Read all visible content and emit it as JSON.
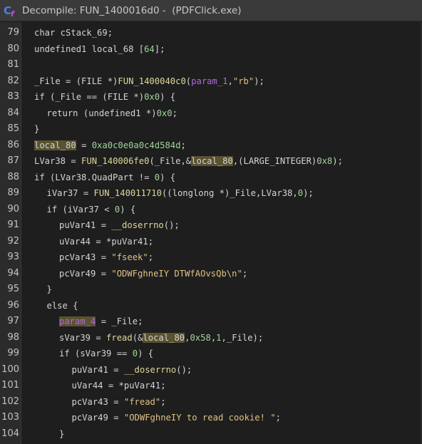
{
  "window": {
    "title": "Decompile: FUN_1400016d0 -  (PDFClick.exe)",
    "icon": "decompiler-icon"
  },
  "colors": {
    "background": "#1e1e1e",
    "text": "#d4d4d4",
    "function": "#ded89a",
    "number": "#9fd49a",
    "string": "#e0c184",
    "parameter": "#b06ad8",
    "highlight": "#5a5230"
  },
  "lines": [
    {
      "num": "79",
      "indent": 1,
      "tokens": [
        [
          "char cStack_69;",
          "t"
        ]
      ]
    },
    {
      "num": "80",
      "indent": 1,
      "tokens": [
        [
          "undefined1 local_68 [",
          "t"
        ],
        [
          "64",
          "n"
        ],
        [
          "];",
          "t"
        ]
      ]
    },
    {
      "num": "81",
      "indent": 0,
      "tokens": []
    },
    {
      "num": "82",
      "indent": 1,
      "tokens": [
        [
          "_File = (FILE *)",
          "t"
        ],
        [
          "FUN_1400040c0",
          "f"
        ],
        [
          "(",
          "t"
        ],
        [
          "param_1",
          "p"
        ],
        [
          ",",
          "t"
        ],
        [
          "\"rb\"",
          "s"
        ],
        [
          ");",
          "t"
        ]
      ]
    },
    {
      "num": "83",
      "indent": 1,
      "tokens": [
        [
          "if (_File == (FILE *)",
          "t"
        ],
        [
          "0x0",
          "n"
        ],
        [
          ") {",
          "t"
        ]
      ]
    },
    {
      "num": "84",
      "indent": 2,
      "tokens": [
        [
          "return (undefined1 *)",
          "t"
        ],
        [
          "0x0",
          "n"
        ],
        [
          ";",
          "t"
        ]
      ]
    },
    {
      "num": "85",
      "indent": 1,
      "tokens": [
        [
          "}",
          "t"
        ]
      ]
    },
    {
      "num": "86",
      "indent": 1,
      "tokens": [
        [
          "local_80",
          "h"
        ],
        [
          " = ",
          "t"
        ],
        [
          "0xa0c0e0a0c4d584d",
          "n"
        ],
        [
          ";",
          "t"
        ]
      ]
    },
    {
      "num": "87",
      "indent": 1,
      "tokens": [
        [
          "LVar38 = ",
          "t"
        ],
        [
          "FUN_140006fe0",
          "f"
        ],
        [
          "(_File,&",
          "t"
        ],
        [
          "local_80",
          "h"
        ],
        [
          ",(LARGE_INTEGER)",
          "t"
        ],
        [
          "0x8",
          "n"
        ],
        [
          ");",
          "t"
        ]
      ]
    },
    {
      "num": "88",
      "indent": 1,
      "tokens": [
        [
          "if (LVar38.QuadPart != ",
          "t"
        ],
        [
          "0",
          "n"
        ],
        [
          ") {",
          "t"
        ]
      ]
    },
    {
      "num": "89",
      "indent": 2,
      "tokens": [
        [
          "iVar37 = ",
          "t"
        ],
        [
          "FUN_140011710",
          "f"
        ],
        [
          "((longlong *)_File,LVar38,",
          "t"
        ],
        [
          "0",
          "n"
        ],
        [
          ");",
          "t"
        ]
      ]
    },
    {
      "num": "90",
      "indent": 2,
      "tokens": [
        [
          "if (iVar37 < ",
          "t"
        ],
        [
          "0",
          "n"
        ],
        [
          ") {",
          "t"
        ]
      ]
    },
    {
      "num": "91",
      "indent": 3,
      "tokens": [
        [
          "puVar41 = ",
          "t"
        ],
        [
          "__doserrno",
          "f"
        ],
        [
          "();",
          "t"
        ]
      ]
    },
    {
      "num": "92",
      "indent": 3,
      "tokens": [
        [
          "uVar44 = *puVar41;",
          "t"
        ]
      ]
    },
    {
      "num": "93",
      "indent": 3,
      "tokens": [
        [
          "pcVar43 = ",
          "t"
        ],
        [
          "\"fseek\"",
          "s"
        ],
        [
          ";",
          "t"
        ]
      ]
    },
    {
      "num": "94",
      "indent": 3,
      "tokens": [
        [
          "pcVar49 = ",
          "t"
        ],
        [
          "\"ODWFghneIY DTWfAOvsQb\\n\"",
          "s"
        ],
        [
          ";",
          "t"
        ]
      ]
    },
    {
      "num": "95",
      "indent": 2,
      "tokens": [
        [
          "}",
          "t"
        ]
      ]
    },
    {
      "num": "96",
      "indent": 2,
      "tokens": [
        [
          "else {",
          "t"
        ]
      ]
    },
    {
      "num": "97",
      "indent": 3,
      "tokens": [
        [
          "param_4",
          "ph"
        ],
        [
          " = _File;",
          "t"
        ]
      ]
    },
    {
      "num": "98",
      "indent": 3,
      "tokens": [
        [
          "sVar39 = ",
          "t"
        ],
        [
          "fread",
          "f"
        ],
        [
          "(&",
          "t"
        ],
        [
          "local_80",
          "h"
        ],
        [
          ",",
          "t"
        ],
        [
          "0x58",
          "n"
        ],
        [
          ",",
          "t"
        ],
        [
          "1",
          "n"
        ],
        [
          ",_File);",
          "t"
        ]
      ]
    },
    {
      "num": "99",
      "indent": 3,
      "tokens": [
        [
          "if (sVar39 == ",
          "t"
        ],
        [
          "0",
          "n"
        ],
        [
          ") {",
          "t"
        ]
      ]
    },
    {
      "num": "100",
      "indent": 4,
      "tokens": [
        [
          "puVar41 = ",
          "t"
        ],
        [
          "__doserrno",
          "f"
        ],
        [
          "();",
          "t"
        ]
      ]
    },
    {
      "num": "101",
      "indent": 4,
      "tokens": [
        [
          "uVar44 = *puVar41;",
          "t"
        ]
      ]
    },
    {
      "num": "102",
      "indent": 4,
      "tokens": [
        [
          "pcVar43 = ",
          "t"
        ],
        [
          "\"fread\"",
          "s"
        ],
        [
          ";",
          "t"
        ]
      ]
    },
    {
      "num": "103",
      "indent": 4,
      "tokens": [
        [
          "pcVar49 = ",
          "t"
        ],
        [
          "\"ODWFghneIY to read cookie! \"",
          "s"
        ],
        [
          ";",
          "t"
        ]
      ]
    },
    {
      "num": "104",
      "indent": 3,
      "tokens": [
        [
          "}",
          "t"
        ]
      ]
    }
  ]
}
